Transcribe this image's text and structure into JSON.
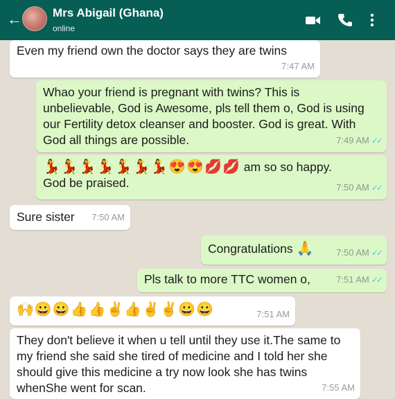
{
  "header": {
    "back_glyph": "←",
    "contact_name": "Mrs Abigail (Ghana)",
    "status": "online",
    "icons": [
      "back-arrow-icon",
      "video-call-icon",
      "phone-icon",
      "more-options-icon"
    ],
    "color": "#075e54"
  },
  "messages": [
    {
      "direction": "incoming",
      "text": "Even my friend own the doctor says they are twins",
      "time": "7:47 AM"
    },
    {
      "direction": "outgoing",
      "text": "Whao  your friend is pregnant with twins? This is unbelievable, God is Awesome, pls tell them o, God is using our Fertility detox cleanser and booster.  God is great.  With God all things are possible.",
      "time": "7:49 AM",
      "ticks": "✓✓"
    },
    {
      "direction": "outgoing",
      "emoji": "💃💃💃💃💃💃💃😍😍💋💋",
      "text": " am so so happy.",
      "text2": "God be praised.",
      "time": "7:50 AM",
      "ticks": "✓✓"
    },
    {
      "direction": "incoming",
      "text": "Sure sister",
      "time": "7:50 AM"
    },
    {
      "direction": "outgoing",
      "text": "Congratulations ",
      "emoji": "🙏",
      "time": "7:50 AM",
      "ticks": "✓✓"
    },
    {
      "direction": "outgoing",
      "text": "Pls talk to more TTC women o,",
      "time": "7:51 AM",
      "ticks": "✓✓"
    },
    {
      "direction": "incoming",
      "emoji": "🙌😀😀👍👍✌👍✌✌😀😀",
      "time": "7:51 AM"
    },
    {
      "direction": "incoming",
      "text": "They don't believe it when u tell until they use it.The same to my friend she said she tired of medicine and I told her she should give this medicine a try now look she has twins whenShe went for scan.",
      "time": "7:55 AM"
    }
  ],
  "colors": {
    "outgoing_bubble": "#dcf8c6",
    "incoming_bubble": "#ffffff",
    "read_ticks": "#4fc3f7"
  }
}
